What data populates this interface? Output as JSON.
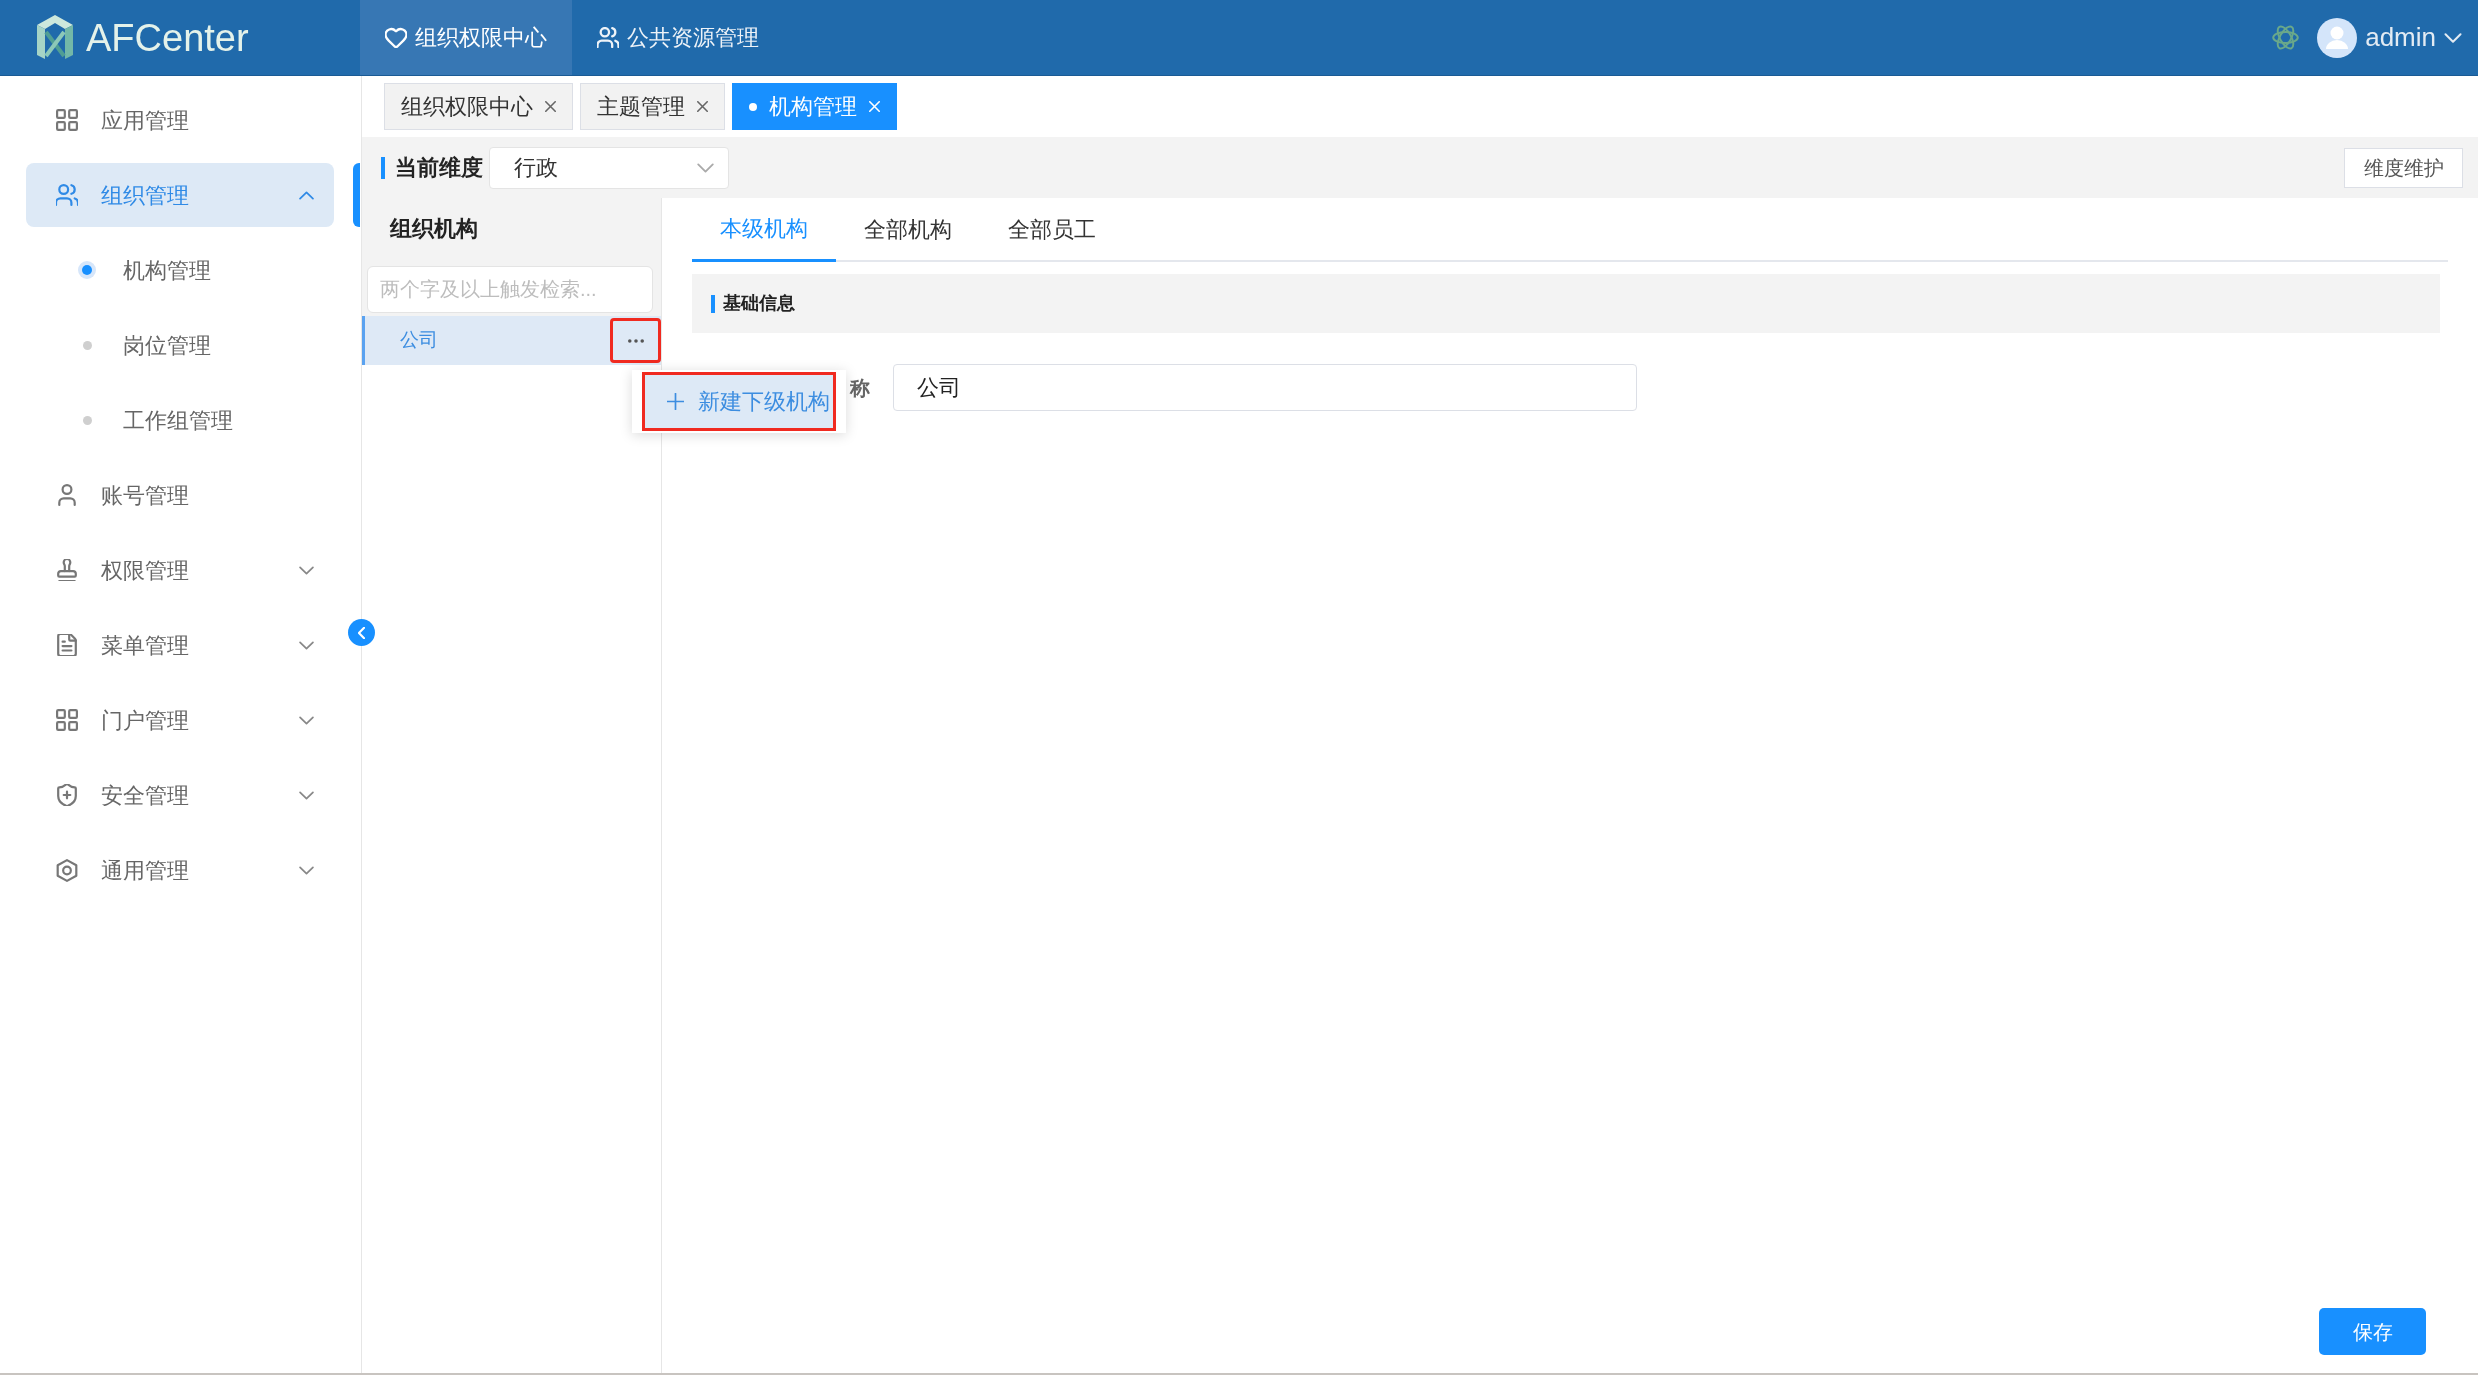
{
  "header": {
    "logo": "AFCenter",
    "nav": [
      {
        "label": "组织权限中心",
        "selected": true
      },
      {
        "label": "公共资源管理",
        "selected": false
      }
    ],
    "user": {
      "name": "admin"
    }
  },
  "sidebar": {
    "items": [
      {
        "label": "应用管理",
        "selected": false
      },
      {
        "label": "组织管理",
        "selected": true,
        "expanded": true,
        "children": [
          {
            "label": "机构管理",
            "selected": true
          },
          {
            "label": "岗位管理",
            "selected": false
          },
          {
            "label": "工作组管理",
            "selected": false
          }
        ]
      },
      {
        "label": "账号管理",
        "selected": false
      },
      {
        "label": "权限管理",
        "selected": false,
        "expanded": false
      },
      {
        "label": "菜单管理",
        "selected": false,
        "expanded": false
      },
      {
        "label": "门户管理",
        "selected": false,
        "expanded": false
      },
      {
        "label": "安全管理",
        "selected": false,
        "expanded": false
      },
      {
        "label": "通用管理",
        "selected": false,
        "expanded": false
      }
    ]
  },
  "page_tabs": [
    {
      "label": "组织权限中心",
      "selected": false
    },
    {
      "label": "主题管理",
      "selected": false
    },
    {
      "label": "机构管理",
      "selected": true
    }
  ],
  "dimension": {
    "label": "当前维度",
    "value": "行政",
    "maintain_button": "维度维护"
  },
  "org_panel": {
    "title": "组织机构",
    "search": {
      "placeholder": "两个字及以上触发检索..."
    },
    "tree": [
      {
        "label": "公司",
        "selected": true,
        "more_highlighted": true
      }
    ],
    "menu": {
      "items": [
        {
          "label": "新建下级机构",
          "selected": true,
          "highlighted": true
        }
      ]
    }
  },
  "detail": {
    "tabs": [
      {
        "label": "本级机构",
        "selected": true
      },
      {
        "label": "全部机构",
        "selected": false
      },
      {
        "label": "全部员工",
        "selected": false
      }
    ],
    "section": "基础信息",
    "fields": [
      {
        "label": "称",
        "value": "公司"
      }
    ],
    "save_button": "保存"
  }
}
